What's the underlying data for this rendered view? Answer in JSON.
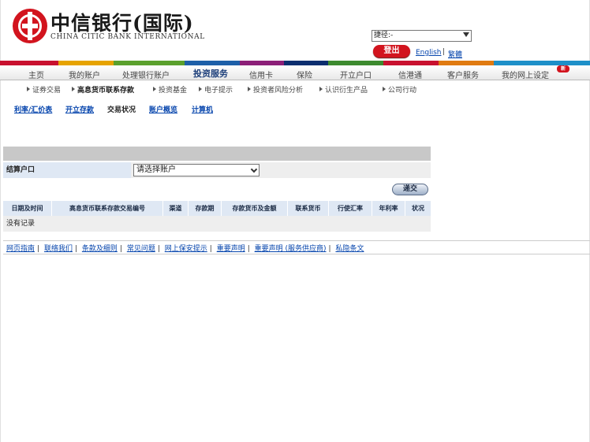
{
  "header": {
    "brand_cn": "中信银行(国际)",
    "brand_en": "CHINA CITIC BANK INTERNATIONAL",
    "shortcut_select": "捷径:-",
    "logout_label": "登出",
    "lang_english": "English",
    "lang_separator": "|",
    "lang_traditional": "繁體"
  },
  "color_strip": [
    "#c8102e",
    "#e6a300",
    "#5aa02c",
    "#1d5fa8",
    "#8c1f78",
    "#0a2d6e",
    "#3c8a2e",
    "#c8102e",
    "#e07a10",
    "#1d8fc8"
  ],
  "menu": {
    "items": [
      "主页",
      "我的账户",
      "处理银行账户",
      "投资服务",
      "信用卡",
      "保险",
      "开立户口",
      "信港通",
      "客户服务",
      "我的网上设定"
    ],
    "new_badge": "新"
  },
  "submenu": {
    "items": [
      "证券交易",
      "高息货币联系存款",
      "投资基金",
      "电子提示",
      "投资者风险分析",
      "认识衍生产品",
      "公司行动"
    ]
  },
  "tabs": {
    "items": [
      "利率/汇价表",
      "开立存款",
      "交易状况",
      "账户概览",
      "计算机"
    ]
  },
  "form": {
    "account_label": "结算户口",
    "account_select": "请选择账户",
    "submit_label": "递交"
  },
  "table": {
    "headers": [
      "日期及时间",
      "高息货币联系存款交易编号",
      "渠道",
      "存款期",
      "存款货币及金额",
      "联系货币",
      "行使汇率",
      "年利率",
      "状况"
    ],
    "empty_text": "没有记录"
  },
  "footer": {
    "links": [
      "网页指南",
      "联络我们",
      "条款及细则",
      "常见问题",
      "网上保安提示",
      "重要声明",
      "重要声明 (服务供应商)",
      "私隐条文"
    ],
    "separator": "|"
  }
}
